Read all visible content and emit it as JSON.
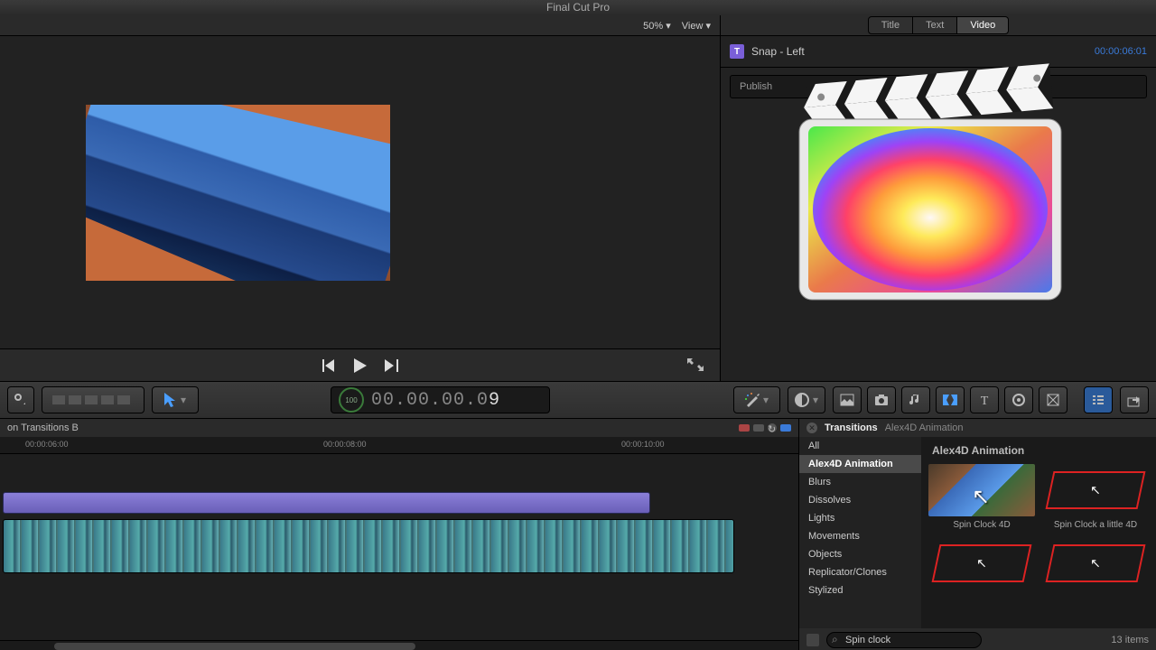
{
  "app_title": "Final Cut Pro",
  "viewer": {
    "zoom": "50%",
    "view_label": "View"
  },
  "inspector": {
    "tabs": [
      "Title",
      "Text",
      "Video"
    ],
    "item_name": "Snap - Left",
    "timecode": "00:00:06:01",
    "publish": "Publish"
  },
  "timecode": {
    "ring": "100",
    "digits": "00.00.00.09",
    "hi_index": 10
  },
  "timeline": {
    "name": "on Transitions B",
    "markers": [
      "00:00:06:00",
      "00:00:08:00",
      "00:00:10:00"
    ]
  },
  "browser": {
    "title": "Transitions",
    "crumb": "Alex4D Animation",
    "categories": [
      "All",
      "Alex4D Animation",
      "Blurs",
      "Dissolves",
      "Lights",
      "Movements",
      "Objects",
      "Replicator/Clones",
      "Stylized"
    ],
    "selected_category": 1,
    "grid_title": "Alex4D Animation",
    "items": [
      "Spin Clock 4D",
      "Spin Clock a little 4D",
      "",
      ""
    ],
    "search_value": "Spin clock",
    "search_placeholder": "Search",
    "count": "13 items"
  }
}
